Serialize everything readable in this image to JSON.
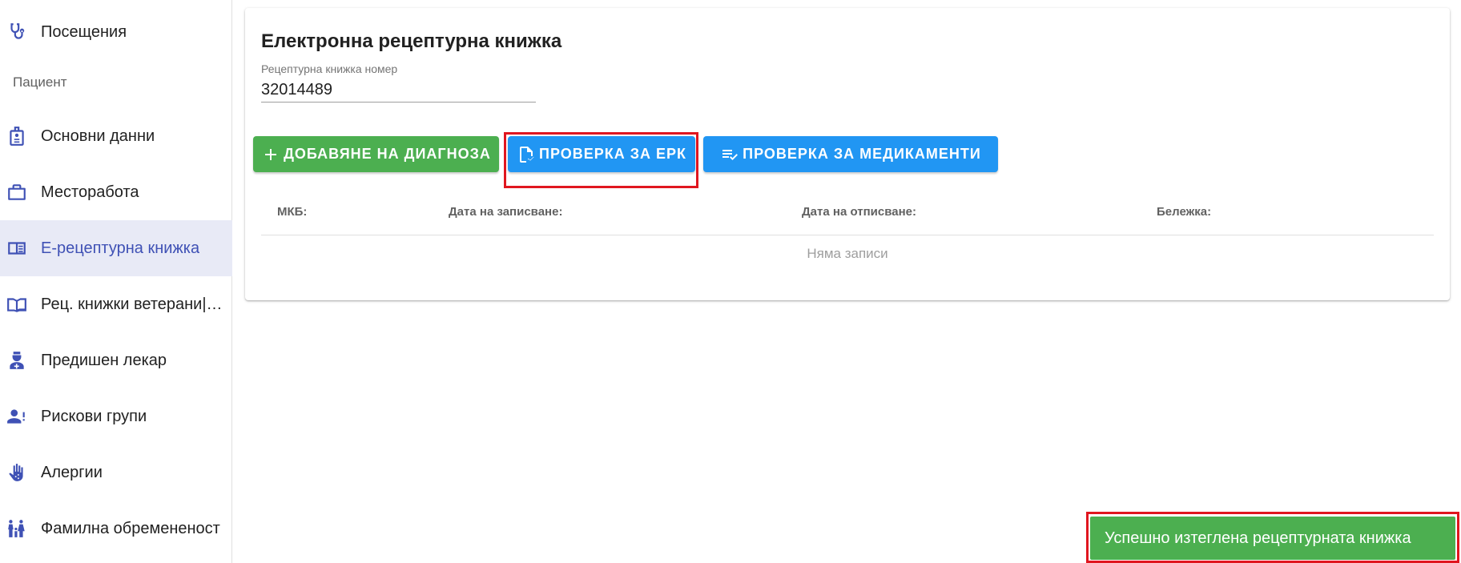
{
  "sidebar": {
    "items": [
      {
        "label": "Посещения",
        "icon": "stethoscope-icon"
      },
      {
        "label": "Основни данни",
        "icon": "id-badge-icon"
      },
      {
        "label": "Месторабота",
        "icon": "briefcase-icon"
      },
      {
        "label": "Е-рецептурна книжка",
        "icon": "book-card-icon"
      },
      {
        "label": "Рец. книжки ветерани|…",
        "icon": "book-open-icon"
      },
      {
        "label": "Предишен лекар",
        "icon": "doctor-icon"
      },
      {
        "label": "Рискови групи",
        "icon": "person-alert-icon"
      },
      {
        "label": "Алергии",
        "icon": "hand-allergy-icon"
      },
      {
        "label": "Фамилна обремененост",
        "icon": "family-icon"
      }
    ],
    "section_patient": "Пациент"
  },
  "card": {
    "title": "Електронна рецептурна книжка",
    "book_number_label": "Рецептурна книжка номер",
    "book_number_value": "32014489"
  },
  "buttons": {
    "add_diagnosis": "ДОБАВЯНЕ НА ДИАГНОЗА",
    "check_erk": "ПРОВЕРКА ЗА ЕРК",
    "check_medications": "ПРОВЕРКА ЗА МЕДИКАМЕНТИ"
  },
  "table": {
    "columns": [
      "МКБ:",
      "Дата на записване:",
      "Дата на отписване:",
      "Бележка:"
    ],
    "empty_text": "Няма записи"
  },
  "snackbar": {
    "message": "Успешно изтеглена рецептурната книжка"
  },
  "colors": {
    "primary_blue": "#2196f3",
    "success_green": "#4caf50",
    "active_nav_bg": "#e8eaf6",
    "active_nav_text": "#3f51b5",
    "highlight_red": "#e0161f"
  }
}
